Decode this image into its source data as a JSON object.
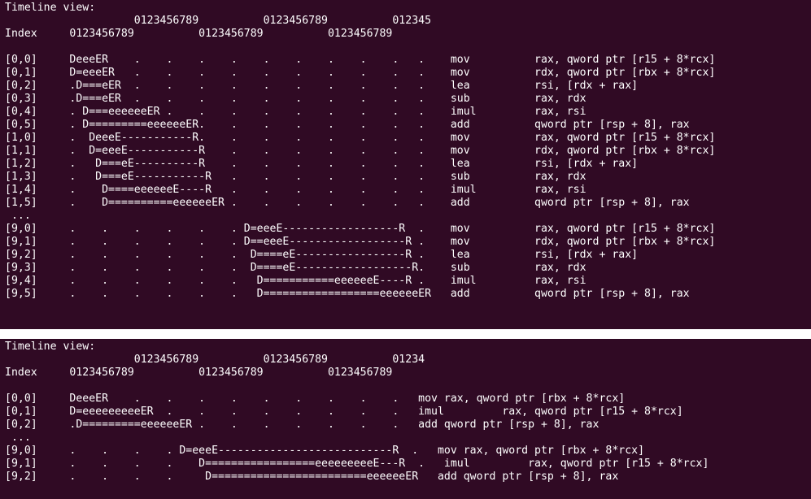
{
  "theme": {
    "background": "#300a24",
    "foreground": "#ffffff"
  },
  "panel_1": {
    "lines": [
      "Timeline view:",
      "                    0123456789          0123456789          012345",
      "Index     0123456789          0123456789          0123456789",
      "",
      "[0,0]     DeeeER    .    .    .    .    .    .    .    .    .   .    mov          rax, qword ptr [r15 + 8*rcx]",
      "[0,1]     D=eeeER   .    .    .    .    .    .    .    .    .   .    mov          rdx, qword ptr [rbx + 8*rcx]",
      "[0,2]     .D===eER  .    .    .    .    .    .    .    .    .   .    lea          rsi, [rdx + rax]",
      "[0,3]     .D===eER  .    .    .    .    .    .    .    .    .   .    sub          rax, rdx",
      "[0,4]     . D===eeeeeeER .    .    .    .    .    .    .    .   .    imul         rax, rsi",
      "[0,5]     . D=========eeeeeeER.    .    .    .    .    .    .   .    add          qword ptr [rsp + 8], rax",
      "[1,0]     .  DeeeE-----------R.    .    .    .    .    .    .   .    mov          rax, qword ptr [r15 + 8*rcx]",
      "[1,1]     .  D=eeeE-----------R    .    .    .    .    .    .   .    mov          rdx, qword ptr [rbx + 8*rcx]",
      "[1,2]     .   D===eE----------R    .    .    .    .    .    .   .    lea          rsi, [rdx + rax]",
      "[1,3]     .   D===eE-----------R   .    .    .    .    .    .   .    sub          rax, rdx",
      "[1,4]     .    D====eeeeeeE----R   .    .    .    .    .    .   .    imul         rax, rsi",
      "[1,5]     .    D==========eeeeeeER .    .    .    .    .    .   .    add          qword ptr [rsp + 8], rax",
      " ...",
      "[9,0]     .    .    .    .    .    . D=eeeE------------------R  .    mov          rax, qword ptr [r15 + 8*rcx]",
      "[9,1]     .    .    .    .    .    . D==eeeE------------------R .    mov          rdx, qword ptr [rbx + 8*rcx]",
      "[9,2]     .    .    .    .    .    .  D====eE-----------------R .    lea          rsi, [rdx + rax]",
      "[9,3]     .    .    .    .    .    .  D====eE------------------R.    sub          rax, rdx",
      "[9,4]     .    .    .    .    .    .   D===========eeeeeeE----R .    imul         rax, rsi",
      "[9,5]     .    .    .    .    .    .   D==================eeeeeeER   add          qword ptr [rsp + 8], rax"
    ]
  },
  "panel_2": {
    "lines": [
      "Timeline view:",
      "                    0123456789          0123456789          01234",
      "Index     0123456789          0123456789          0123456789",
      "",
      "[0,0]     DeeeER    .    .    .    .    .    .    .    .    .   mov rax, qword ptr [rbx + 8*rcx]",
      "[0,1]     D=eeeeeeeeeER  .    .    .    .    .    .    .    .   imul         rax, qword ptr [r15 + 8*rcx]",
      "[0,2]     .D=========eeeeeeER .    .    .    .    .    .    .   add qword ptr [rsp + 8], rax",
      " ...",
      "[9,0]     .    .    .    . D=eeeE---------------------------R  .   mov rax, qword ptr [rbx + 8*rcx]",
      "[9,1]     .    .    .    .    D=================eeeeeeeeeE---R  .   imul         rax, qword ptr [r15 + 8*rcx]",
      "[9,2]     .    .    .    .     D========================eeeeeeER   add qword ptr [rsp + 8], rax"
    ]
  }
}
